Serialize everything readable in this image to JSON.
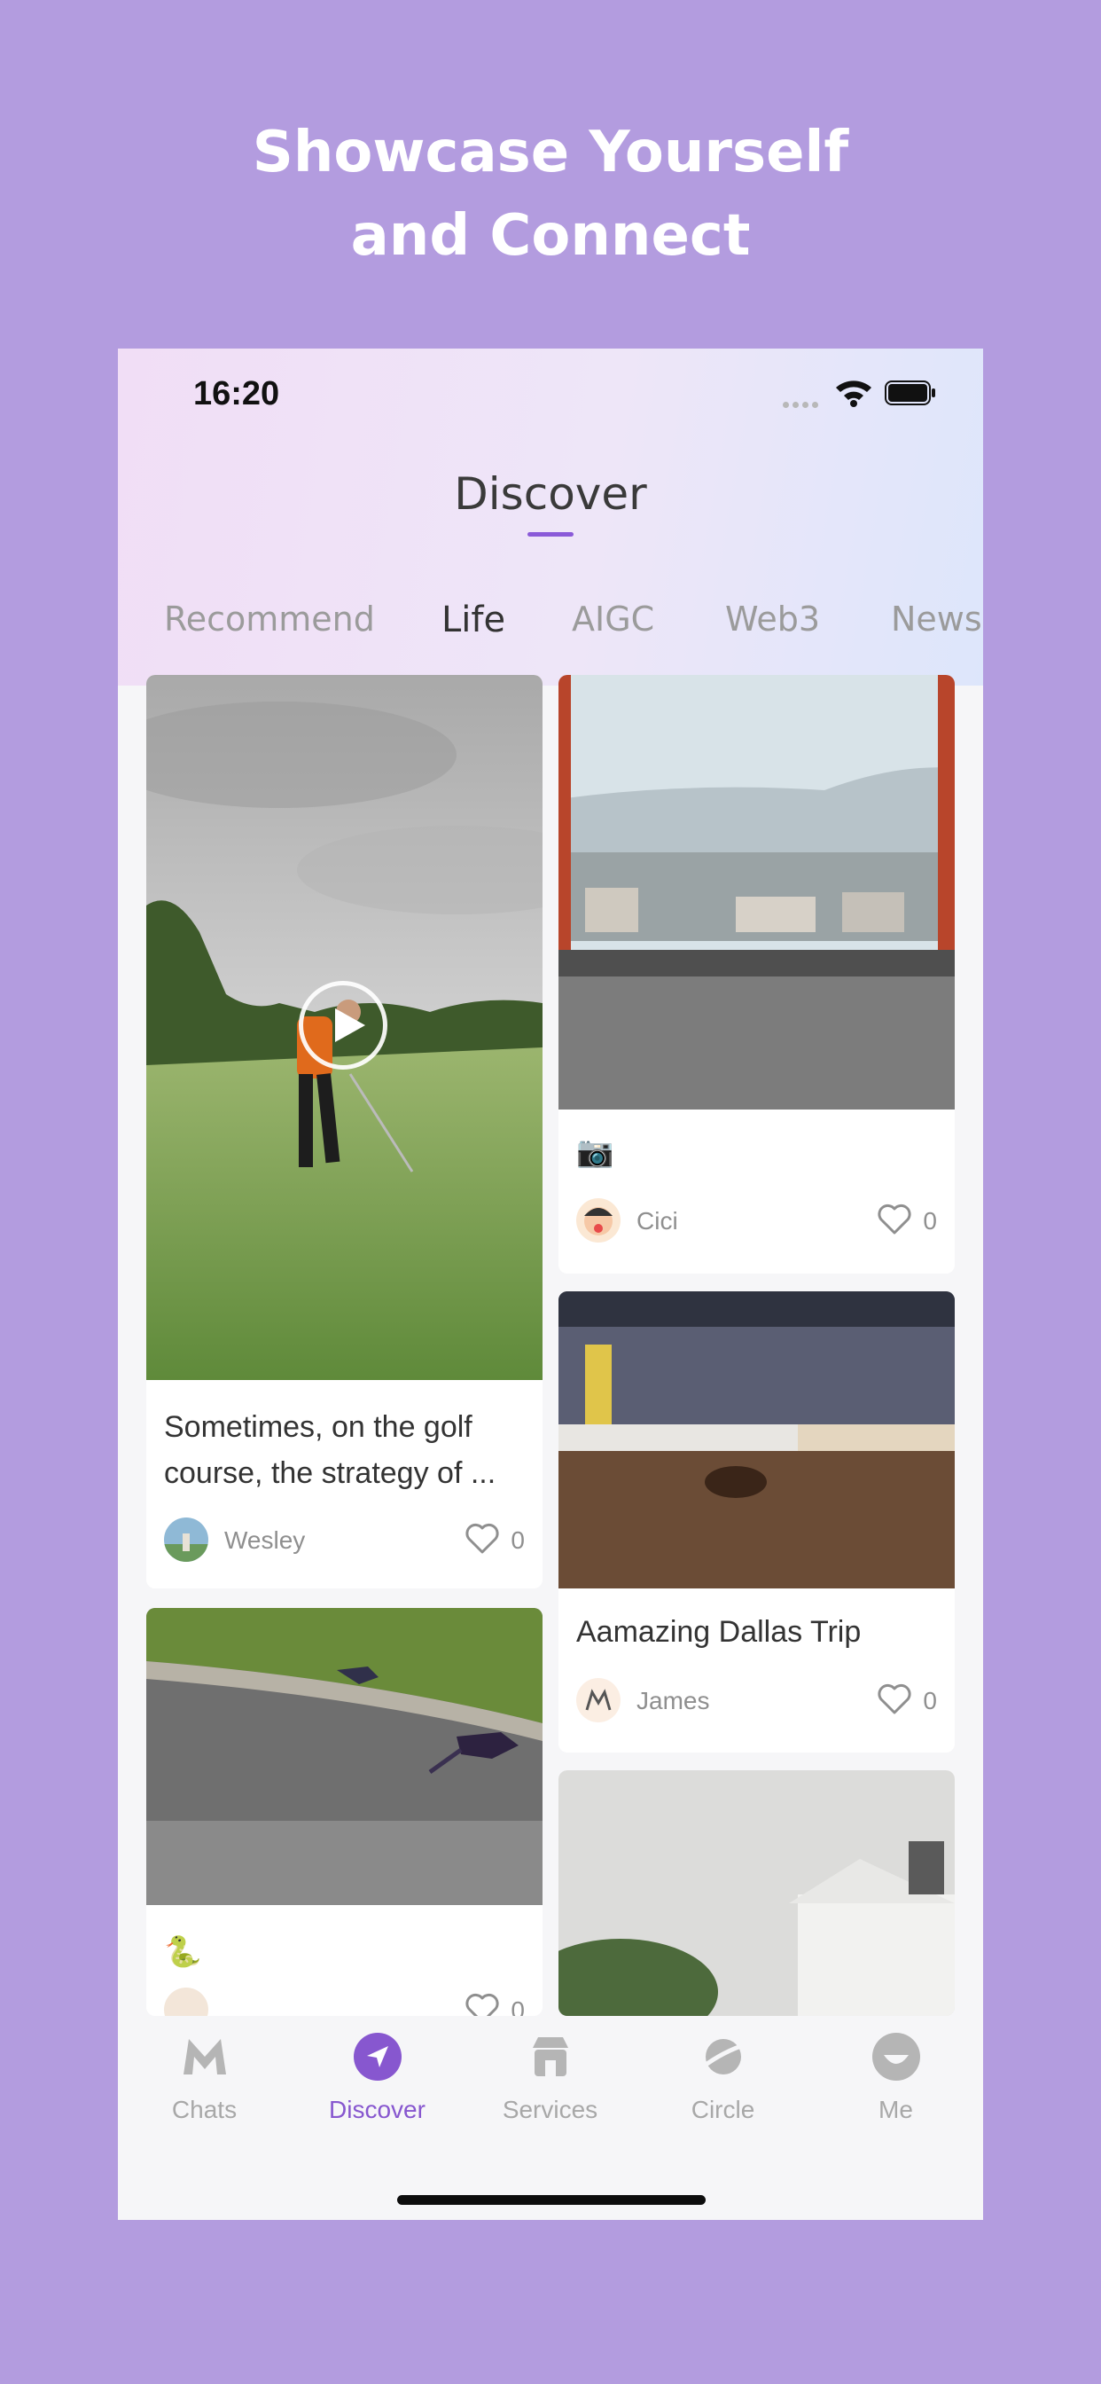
{
  "headline": {
    "line1": "Showcase Yourself",
    "line2": "and Connect"
  },
  "status_bar": {
    "time": "16:20"
  },
  "nav": {
    "title": "Discover"
  },
  "tabs": [
    {
      "label": "Recommend"
    },
    {
      "label": "Life"
    },
    {
      "label": "AIGC"
    },
    {
      "label": "Web3"
    },
    {
      "label": "News"
    }
  ],
  "active_tab": "Life",
  "feed": {
    "golf": {
      "title": "Sometimes, on the golf course, the strategy of ...",
      "user": "Wesley",
      "likes": "0"
    },
    "kyoto": {
      "emoji": "📷",
      "user": "Cici",
      "likes": "0"
    },
    "dallas": {
      "title": "Aamazing Dallas Trip",
      "user": "James",
      "likes": "0"
    },
    "bird": {
      "emoji": "🐍",
      "likes": "0"
    }
  },
  "tabbar": [
    {
      "label": "Chats"
    },
    {
      "label": "Discover"
    },
    {
      "label": "Services"
    },
    {
      "label": "Circle"
    },
    {
      "label": "Me"
    }
  ],
  "colors": {
    "background": "#b39cdf",
    "accent": "#8757cf",
    "inactive": "#a8a8a8"
  }
}
